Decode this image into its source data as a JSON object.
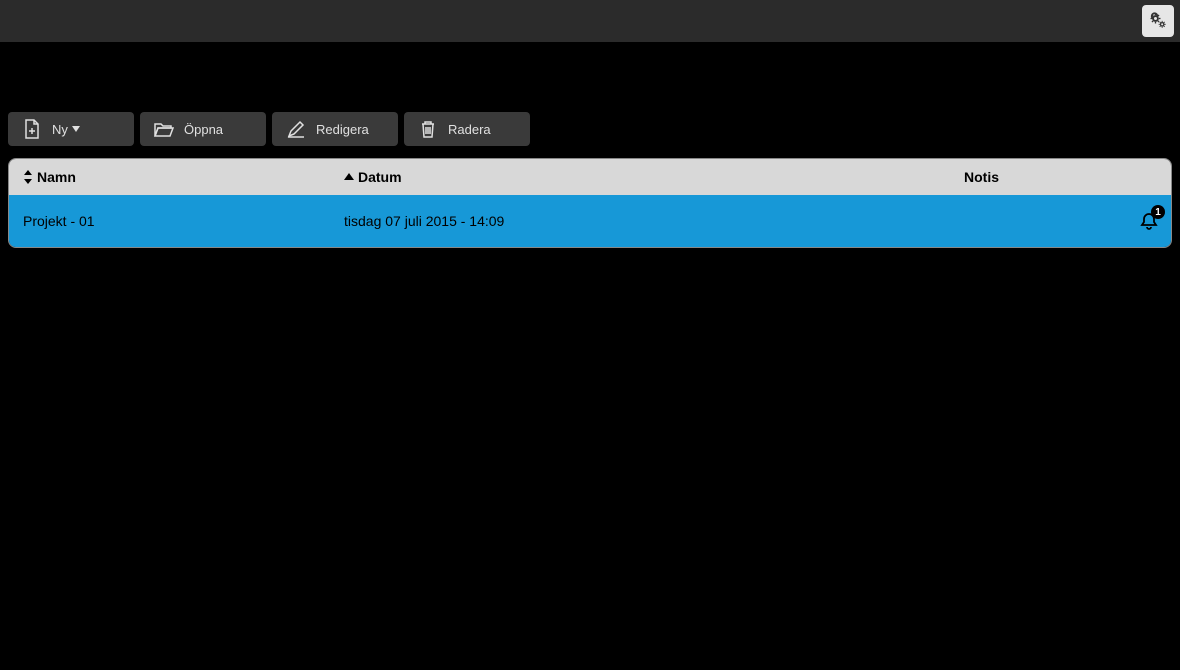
{
  "toolbar": {
    "new_label": "Ny",
    "open_label": "Öppna",
    "edit_label": "Redigera",
    "delete_label": "Radera"
  },
  "table": {
    "headers": {
      "name": "Namn",
      "date": "Datum",
      "notis": "Notis"
    },
    "rows": [
      {
        "name": "Projekt - 01",
        "date": "tisdag 07 juli 2015 - 14:09",
        "notis_count": "1"
      }
    ]
  }
}
